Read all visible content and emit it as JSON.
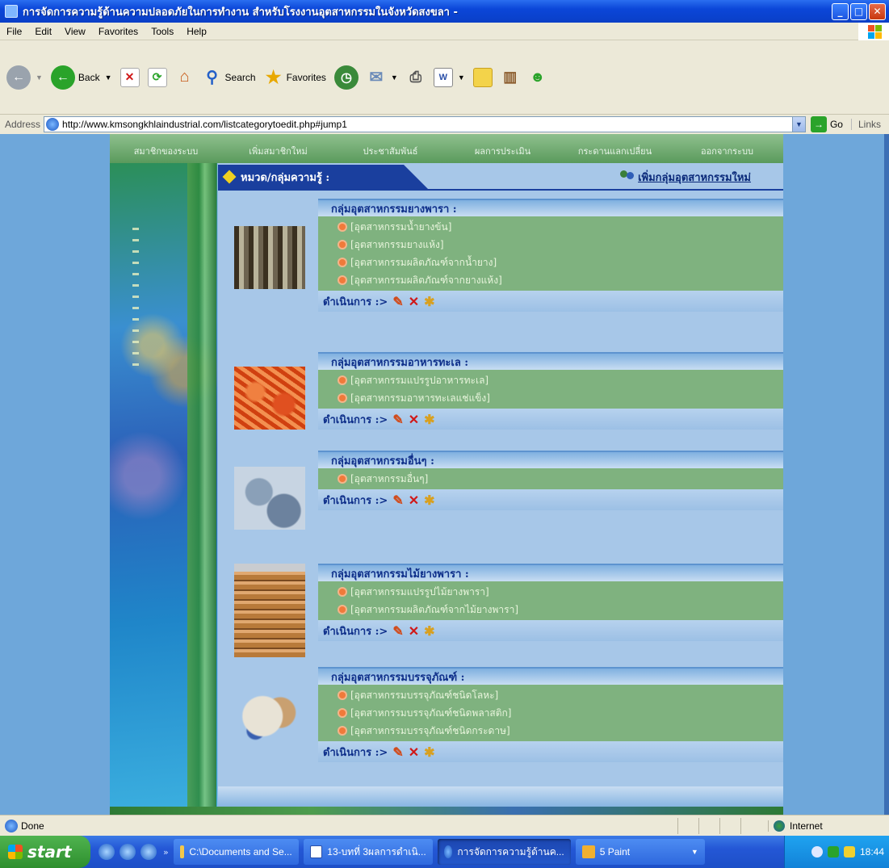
{
  "window": {
    "title": "การจัดการความรู้ด้านความปลอดภัยในการทำงาน สำหรับโรงงานอุตสาหกรรมในจังหวัดสงขลา -"
  },
  "menubar": {
    "items": [
      "File",
      "Edit",
      "View",
      "Favorites",
      "Tools",
      "Help"
    ]
  },
  "toolbar": {
    "back_label": "Back",
    "search_label": "Search",
    "favorites_label": "Favorites"
  },
  "addressbar": {
    "label": "Address",
    "url": "http://www.kmsongkhlaindustrial.com/listcategorytoedit.php#jump1",
    "go_label": "Go",
    "links_label": "Links"
  },
  "site": {
    "nav": [
      "สมาชิกของระบบ",
      "เพิ่มสมาชิกใหม่",
      "ประชาสัมพันธ์",
      "ผลการประเมิน",
      "กระดานแลกเปลี่ยน",
      "ออกจากระบบ"
    ],
    "section_title": "หมวด/กลุ่มความรู้ :",
    "add_group_label": "เพิ่มกลุ่มอุตสาหกรรมใหม่",
    "actions_label": "ดำเนินการ :>",
    "groups": [
      {
        "title": "กลุ่มอุตสาหกรรมยางพารา :",
        "items": [
          "[อุตสาหกรรมน้ำยางข้น]",
          "[อุตสาหกรรมยางแห้ง]",
          "[อุตสาหกรรมผลิตภัณฑ์จากน้ำยาง]",
          "[อุตสาหกรรมผลิตภัณฑ์จากยางแห้ง]"
        ]
      },
      {
        "title": "กลุ่มอุตสาหกรรมอาหารทะเล :",
        "items": [
          "[อุตสาหกรรมแปรรูปอาหารทะเล]",
          "[อุตสาหกรรมอาหารทะเลแช่แข็ง]"
        ]
      },
      {
        "title": "กลุ่มอุตสาหกรรมอื่นๆ :",
        "items": [
          "[อุตสาหกรรมอื่นๆ]"
        ]
      },
      {
        "title": "กลุ่มอุตสาหกรรมไม้ยางพารา :",
        "items": [
          "[อุตสาหกรรมแปรรูปไม้ยางพารา]",
          "[อุตสาหกรรมผลิตภัณฑ์จากไม้ยางพารา]"
        ]
      },
      {
        "title": "กลุ่มอุตสาหกรรมบรรจุภัณฑ์ :",
        "items": [
          "[อุตสาหกรรมบรรจุภัณฑ์ชนิดโลหะ]",
          "[อุตสาหกรรมบรรจุภัณฑ์ชนิดพลาสติก]",
          "[อุตสาหกรรมบรรจุภัณฑ์ชนิดกระดาษ]"
        ]
      }
    ]
  },
  "statusbar": {
    "status": "Done",
    "zone": "Internet"
  },
  "taskbar": {
    "start_label": "start",
    "tasks": [
      "C:\\Documents and Se...",
      "13-บทที่ 3ผลการดำเนิ...",
      "การจัดการความรู้ด้านค...",
      "5 Paint"
    ],
    "clock": "18:44"
  }
}
